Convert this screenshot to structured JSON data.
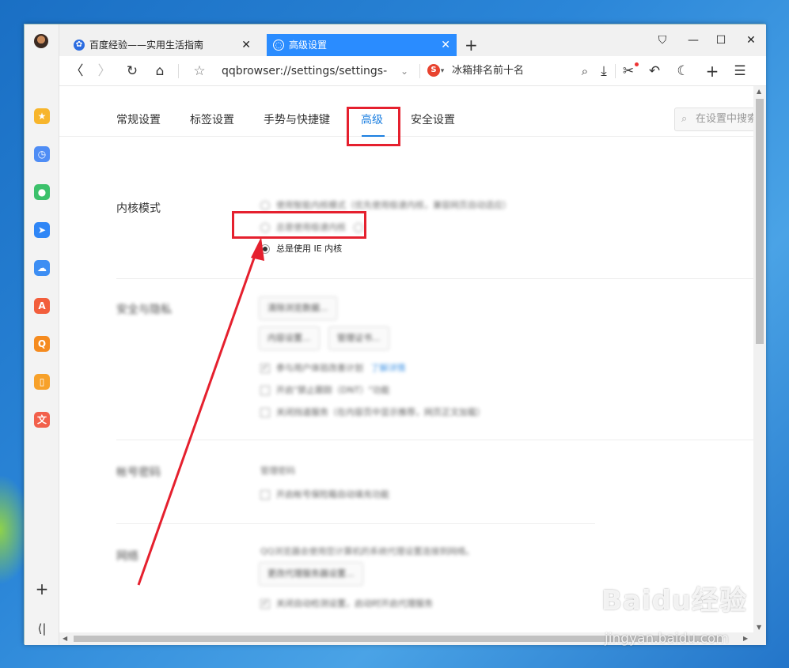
{
  "browser": {
    "tabs": [
      {
        "label": "百度经验——实用生活指南",
        "icon": "baidu-paw-icon",
        "active": false
      },
      {
        "label": "高级设置",
        "icon": "settings-globe-icon",
        "active": true
      }
    ],
    "new_tab_symbol": "+",
    "window_controls": {
      "skin": "shirt-icon",
      "minimize": "—",
      "maximize": "☐",
      "close": "✕"
    },
    "address": "qqbrowser://settings/settings-a",
    "search_engine_icon": "sogou-icon",
    "search_query": "冰箱排名前十名",
    "accent_color": "#2a8cff"
  },
  "sidebar": {
    "icons": [
      "favorites-icon",
      "history-icon",
      "wechat-icon",
      "send-icon",
      "cloud-icon",
      "pdf-icon",
      "search-tool-icon",
      "reader-icon",
      "translate-icon"
    ],
    "add_symbol": "+",
    "collapse_symbol": "⟨|"
  },
  "settings": {
    "nav_tabs": [
      "常规设置",
      "标签设置",
      "手势与快捷键",
      "高级",
      "安全设置"
    ],
    "active_tab": "高级",
    "search_placeholder": "在设置中搜索",
    "kernel": {
      "label": "内核模式",
      "options": [
        "使用智能内核模式（优先使用极速内核，兼容网页自动适应）",
        "总是使用极速内核"
      ],
      "selected_option": "总是使用 IE 内核"
    },
    "security": {
      "label": "安全与隐私",
      "buttons": [
        "清除浏览数据...",
        "内容设置...",
        "管理证书..."
      ],
      "checks": [
        {
          "text": "参与用户体验改善计划",
          "link": "了解详情",
          "checked": true
        },
        {
          "text": "开启\"禁止跟踪（DNT）\"功能",
          "checked": false
        },
        {
          "text": "关闭挡道服务（在内容页中显示推荐，网页正文加载）",
          "checked": false
        }
      ]
    },
    "account": {
      "label": "帐号密码",
      "link": "管理密码",
      "check": "开启帐号保险箱自动填充功能"
    },
    "network": {
      "label": "网络",
      "description": "QQ浏览器会使用您计算机的系统代理设置连接到网络。",
      "button": "更改代理服务器设置...",
      "check": "关闭自动检测设置，启动时开启代理服务"
    }
  },
  "annotation": {
    "color": "#e5202e"
  },
  "watermark": {
    "main": "Baidu经验",
    "sub": "jingyan.baidu.com"
  }
}
